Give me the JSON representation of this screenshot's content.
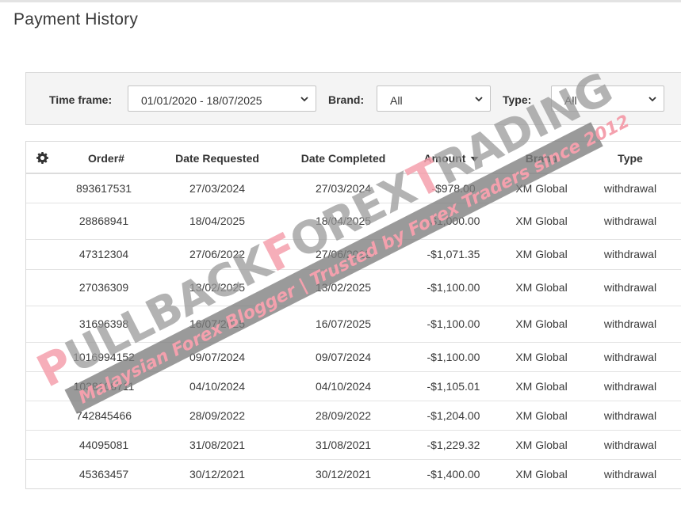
{
  "page": {
    "title": "Payment History"
  },
  "filters": {
    "timeframe_label": "Time frame:",
    "timeframe_value": "01/01/2020 - 18/07/2025",
    "brand_label": "Brand:",
    "brand_value": "All",
    "type_label": "Type:",
    "type_value": "All"
  },
  "table": {
    "columns": {
      "order": "Order#",
      "date_requested": "Date Requested",
      "date_completed": "Date Completed",
      "amount": "Amount",
      "brand": "Brand",
      "type": "Type"
    },
    "sort": {
      "column": "amount",
      "direction": "descending"
    },
    "rows": [
      {
        "order": "893617531",
        "date_requested": "27/03/2024",
        "date_completed": "27/03/2024",
        "amount": "-$978.00",
        "brand": "XM Global",
        "type": "withdrawal"
      },
      {
        "order": "28868941",
        "date_requested": "18/04/2025",
        "date_completed": "18/04/2025",
        "amount": "-$1,000.00",
        "brand": "XM Global",
        "type": "withdrawal"
      },
      {
        "order": "47312304",
        "date_requested": "27/06/2022",
        "date_completed": "27/06/2022",
        "amount": "-$1,071.35",
        "brand": "XM Global",
        "type": "withdrawal"
      },
      {
        "order": "27036309",
        "date_requested": "13/02/2025",
        "date_completed": "13/02/2025",
        "amount": "-$1,100.00",
        "brand": "XM Global",
        "type": "withdrawal"
      },
      {
        "order": "31696398",
        "date_requested": "16/07/2025",
        "date_completed": "16/07/2025",
        "amount": "-$1,100.00",
        "brand": "XM Global",
        "type": "withdrawal"
      },
      {
        "order": "1016994152",
        "date_requested": "09/07/2024",
        "date_completed": "09/07/2024",
        "amount": "-$1,100.00",
        "brand": "XM Global",
        "type": "withdrawal"
      },
      {
        "order": "1038108711",
        "date_requested": "04/10/2024",
        "date_completed": "04/10/2024",
        "amount": "-$1,105.01",
        "brand": "XM Global",
        "type": "withdrawal"
      },
      {
        "order": "742845466",
        "date_requested": "28/09/2022",
        "date_completed": "28/09/2022",
        "amount": "-$1,204.00",
        "brand": "XM Global",
        "type": "withdrawal"
      },
      {
        "order": "44095081",
        "date_requested": "31/08/2021",
        "date_completed": "31/08/2021",
        "amount": "-$1,229.32",
        "brand": "XM Global",
        "type": "withdrawal"
      },
      {
        "order": "45363457",
        "date_requested": "30/12/2021",
        "date_completed": "30/12/2021",
        "amount": "-$1,400.00",
        "brand": "XM Global",
        "type": "withdrawal"
      }
    ]
  },
  "watermark": {
    "line1_prefix": "P",
    "line1_a": "ULLBACK",
    "line1_f": "F",
    "line1_b": "OREX",
    "line1_t": "T",
    "line1_c": "RADING",
    "line2": "Malaysian Forex Blogger | Trusted by Forex Traders since 2012",
    "colors": {
      "accent": "#f4a0ad",
      "grey": "#9a9a9a"
    }
  },
  "icons": {
    "settings": "gear-icon",
    "sort": "caret-down-icon",
    "dropdown": "chevron-down-icon"
  }
}
